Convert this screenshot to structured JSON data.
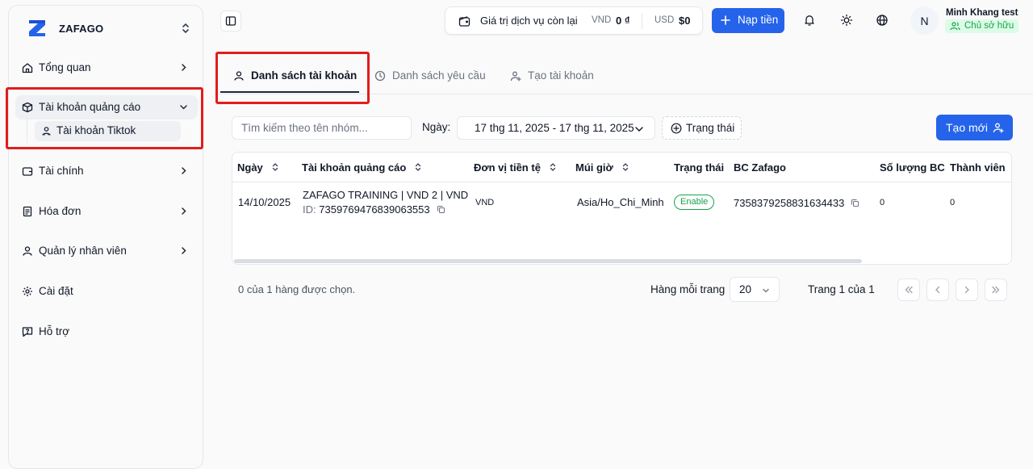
{
  "brand": {
    "name": "ZAFAGO",
    "logo_color": "#2563eb"
  },
  "sidebar": {
    "items": [
      {
        "label": "Tổng quan",
        "icon": "home-icon"
      },
      {
        "label": "Tài khoản quảng cáo",
        "icon": "box-icon",
        "expanded": true,
        "children": [
          {
            "label": "Tài khoản Tiktok",
            "icon": "users-icon"
          }
        ]
      },
      {
        "label": "Tài chính",
        "icon": "wallet-icon"
      },
      {
        "label": "Hóa đơn",
        "icon": "receipt-icon"
      },
      {
        "label": "Quản lý nhân viên",
        "icon": "user-icon"
      },
      {
        "label": "Cài đặt",
        "icon": "gear-icon"
      },
      {
        "label": "Hỗ trợ",
        "icon": "help-chat-icon"
      }
    ]
  },
  "topbar": {
    "balance_label": "Giá trị dịch vụ còn lại",
    "vnd_currency": "VND",
    "vnd_amount": "0 ₫",
    "usd_currency": "USD",
    "usd_amount": "$0",
    "topup_label": "Nạp tiền",
    "user_initial": "N",
    "user_name": "Minh Khang test",
    "user_role": "Chủ sở hữu"
  },
  "tabs": [
    {
      "label": "Danh sách tài khoản",
      "icon": "user-icon",
      "active": true
    },
    {
      "label": "Danh sách yêu cầu",
      "icon": "clock-icon",
      "active": false
    },
    {
      "label": "Tạo tài khoản",
      "icon": "user-plus-icon",
      "active": false
    }
  ],
  "filters": {
    "search_placeholder": "Tìm kiếm theo tên nhóm...",
    "date_label": "Ngày:",
    "date_range": "17 thg 11, 2025 - 17 thg 11, 2025",
    "status_label": "Trạng thái",
    "create_label": "Tạo mới"
  },
  "table": {
    "columns": [
      "Ngày",
      "Tài khoản quảng cáo",
      "Đơn vị tiền tệ",
      "Múi giờ",
      "Trạng thái",
      "BC Zafago",
      "Số lượng BC",
      "Thành viên"
    ],
    "rows": [
      {
        "date": "14/10/2025",
        "account_name": "ZAFAGO TRAINING | VND 2 | VND",
        "account_id_label": "ID:",
        "account_id": "7359769476839063553",
        "currency": "VND",
        "timezone": "Asia/Ho_Chi_Minh",
        "status": "Enable",
        "bc_zafago": "7358379258831634433",
        "bc_count": "0",
        "members": "0"
      }
    ]
  },
  "footer": {
    "selected_text": "0 của 1 hàng được chọn.",
    "rows_per_page_label": "Hàng mỗi trang",
    "rows_per_page": "20",
    "page_text": "Trang 1 của 1"
  },
  "colors": {
    "accent": "#2563eb",
    "success": "#16a34a",
    "highlight_box": "#e11d1d"
  }
}
